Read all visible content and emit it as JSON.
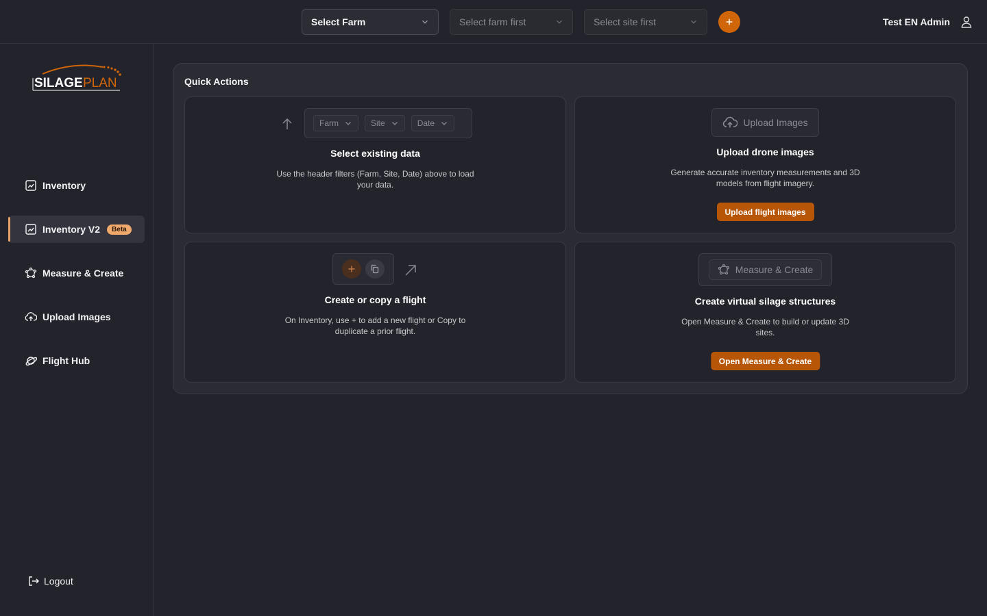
{
  "header": {
    "farm_select": "Select Farm",
    "site_select": "Select farm first",
    "date_select": "Select site first",
    "user_name": "Test EN Admin"
  },
  "logo": {
    "part1": "SILAGE",
    "part2": "PLAN"
  },
  "sidebar": {
    "items": [
      {
        "label": "Inventory",
        "icon": "chart-icon"
      },
      {
        "label": "Inventory V2",
        "icon": "chart-icon",
        "badge": "Beta",
        "active": true
      },
      {
        "label": "Measure & Create",
        "icon": "polygon-icon"
      },
      {
        "label": "Upload Images",
        "icon": "cloud-upload-icon"
      },
      {
        "label": "Flight Hub",
        "icon": "planet-icon"
      }
    ],
    "logout": "Logout"
  },
  "quick_actions": {
    "title": "Quick Actions",
    "select_data": {
      "filters": [
        "Farm",
        "Site",
        "Date"
      ],
      "title": "Select existing data",
      "desc": "Use the header filters (Farm, Site, Date) above to load your data."
    },
    "upload": {
      "ghost_label": "Upload Images",
      "title": "Upload drone images",
      "desc": "Generate accurate inventory measurements and 3D models from flight imagery.",
      "button": "Upload flight images"
    },
    "flight": {
      "title": "Create or copy a flight",
      "desc": "On Inventory, use + to add a new flight or Copy to duplicate a prior flight."
    },
    "measure": {
      "ghost_label": "Measure & Create",
      "title": "Create virtual silage structures",
      "desc": "Open Measure & Create to build or update 3D sites.",
      "button": "Open Measure & Create"
    }
  },
  "colors": {
    "accent": "#d0650a",
    "button": "#b85607",
    "beta_badge": "#f0a96c",
    "background": "#23232b"
  }
}
